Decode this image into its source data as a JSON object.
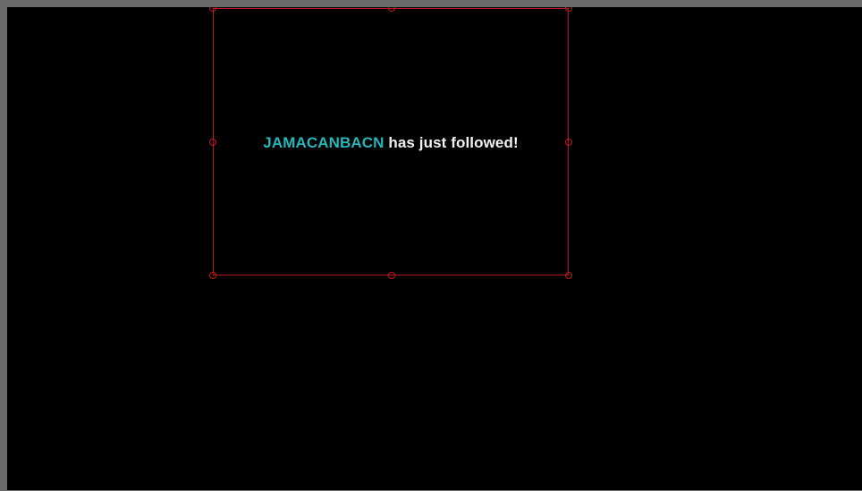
{
  "alert": {
    "username": "JAMACANBACN",
    "message": " has just followed!",
    "username_color": "#23b8bb",
    "message_color": "#f2f2f2"
  },
  "selection": {
    "border_color": "#b81414"
  },
  "canvas": {
    "background_color": "#000000"
  }
}
